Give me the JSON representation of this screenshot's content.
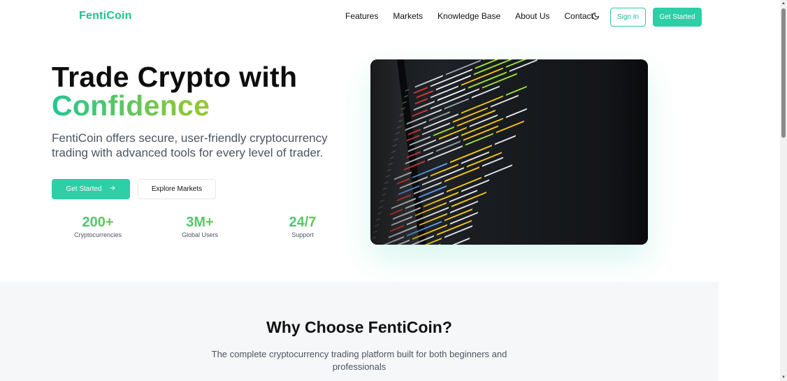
{
  "brand": {
    "name": "FentiCoin",
    "color": "#21c08e",
    "accent": "#2ccfa6"
  },
  "nav": {
    "items": [
      {
        "label": "Features"
      },
      {
        "label": "Markets"
      },
      {
        "label": "Knowledge Base"
      },
      {
        "label": "About Us"
      },
      {
        "label": "Contact"
      }
    ],
    "theme_icon": "moon-icon",
    "sign_in_label": "Sign In",
    "get_started_label": "Get Started"
  },
  "hero": {
    "title_line1": "Trade Crypto with",
    "title_line2": "Confidence",
    "subtitle": "FentiCoin offers secure, user-friendly cryptocurrency trading with advanced tools for every level of trader.",
    "primary_button": {
      "label": "Get Started",
      "icon": "arrow-right-icon"
    },
    "secondary_button": {
      "label": "Explore Markets"
    },
    "stats": [
      {
        "value": "200+",
        "label": "Cryptocurrencies"
      },
      {
        "value": "3M+",
        "label": "Global Users"
      },
      {
        "value": "24/7",
        "label": "Support"
      }
    ],
    "image": {
      "description_icon": "code-screen-image"
    }
  },
  "why": {
    "title": "Why Choose FentiCoin?",
    "subtitle": "The complete cryptocurrency trading platform built for both beginners and professionals"
  }
}
